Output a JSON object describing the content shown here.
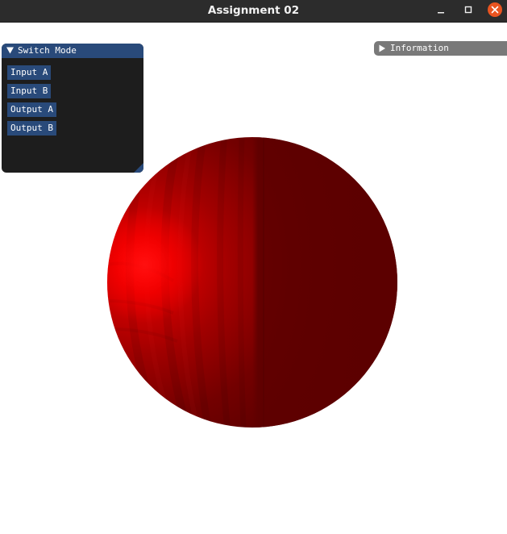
{
  "window": {
    "title": "Assignment 02",
    "controls": {
      "minimize_icon": "minimize-icon",
      "maximize_icon": "maximize-icon",
      "close_icon": "close-icon",
      "close_color": "#e95420"
    }
  },
  "switch_mode_panel": {
    "title": "Switch Mode",
    "expanded": true,
    "header_color": "#294a7a",
    "buttons": [
      {
        "label": "Input A"
      },
      {
        "label": "Input B"
      },
      {
        "label": "Output A"
      },
      {
        "label": "Output B"
      }
    ]
  },
  "information_panel": {
    "title": "Information",
    "expanded": false
  },
  "scene": {
    "object": "sphere",
    "base_color": "#5e0000",
    "highlight_color": "#ff0000",
    "background": "#ffffff"
  }
}
